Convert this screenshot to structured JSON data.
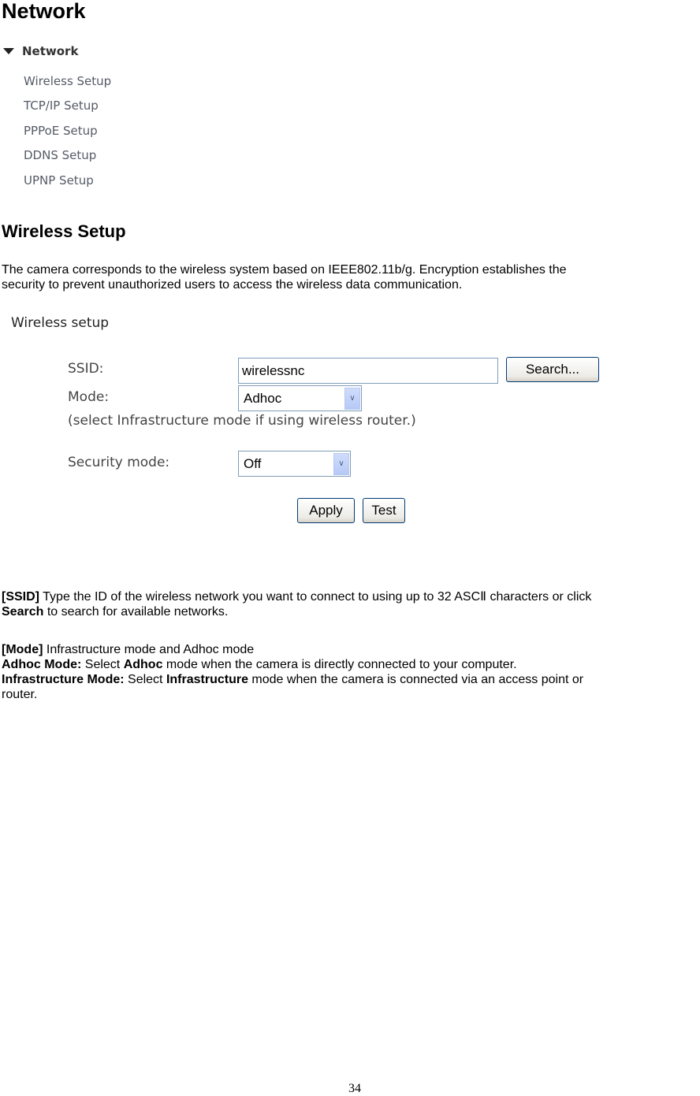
{
  "page": {
    "heading": "Network",
    "page_number": "34"
  },
  "nav_menu": {
    "header": "Network",
    "items": [
      {
        "label": "Wireless Setup"
      },
      {
        "label": "TCP/IP Setup"
      },
      {
        "label": "PPPoE Setup"
      },
      {
        "label": "DDNS Setup"
      },
      {
        "label": "UPNP Setup"
      }
    ]
  },
  "section": {
    "title": "Wireless Setup",
    "intro_line1": "The camera corresponds to the wireless system based on IEEE802.11b/g. Encryption establishes the",
    "intro_line2": "security to prevent unauthorized users to access the wireless data communication."
  },
  "wireless_form": {
    "title": "Wireless setup",
    "ssid_label": "SSID:",
    "ssid_value": "wirelessnc",
    "search_button": "Search...",
    "mode_label": "Mode:",
    "mode_value": "Adhoc",
    "mode_hint": "(select Infrastructure mode if using wireless router.)",
    "security_label": "Security mode:",
    "security_value": "Off",
    "apply_button": "Apply",
    "test_button": "Test"
  },
  "descriptions": {
    "ssid_tag": "[SSID]",
    "ssid_text1": " Type the ID of the wireless network you want to connect to using up to 32 ASCⅡ characters or click",
    "ssid_bold2": "Search",
    "ssid_text2": " to search for available networks.",
    "mode_tag": "[Mode]",
    "mode_text": " Infrastructure mode and Adhoc mode",
    "adhoc_label": "Adhoc Mode:",
    "adhoc_pre": " Select ",
    "adhoc_bold": "Adhoc",
    "adhoc_post": " mode when the camera is directly connected to your computer.",
    "infra_label": "Infrastructure Mode:",
    "infra_pre": " Select ",
    "infra_bold": "Infrastructure",
    "infra_post": " mode when the camera is connected via an access point or",
    "infra_line2": "router."
  }
}
